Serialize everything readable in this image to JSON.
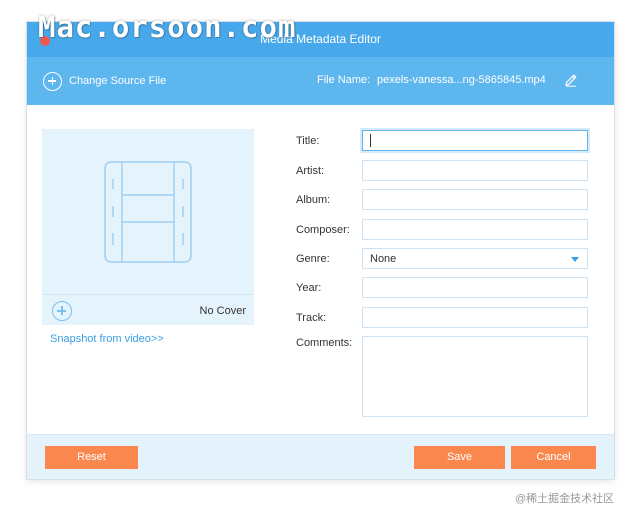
{
  "watermark": "Mac.orsoon.com",
  "window": {
    "title": "Media Metadata Editor"
  },
  "toolbar": {
    "change_source_label": "Change Source File",
    "file_name_label": "File Name:",
    "file_name_value": "pexels-vanessa...ng-5865845.mp4",
    "edit_icon": "pencil-icon"
  },
  "cover": {
    "no_cover_label": "No Cover",
    "snapshot_link": "Snapshot from video>>",
    "art_icon": "film-strip-icon",
    "add_icon": "plus-circle-icon"
  },
  "form": {
    "title_label": "Title:",
    "title_value": "",
    "artist_label": "Artist:",
    "artist_value": "",
    "album_label": "Album:",
    "album_value": "",
    "composer_label": "Composer:",
    "composer_value": "",
    "genre_label": "Genre:",
    "genre_value": "None",
    "year_label": "Year:",
    "year_value": "",
    "track_label": "Track:",
    "track_value": "",
    "comments_label": "Comments:",
    "comments_value": ""
  },
  "footer": {
    "reset_label": "Reset",
    "save_label": "Save",
    "cancel_label": "Cancel"
  },
  "credit": "@稀土掘金技术社区",
  "colors": {
    "titlebar": "#47a9eb",
    "toolbar": "#5eb6ef",
    "accent_link": "#3b9fe4",
    "button": "#f9874e",
    "cover_bg": "#e5f3fc",
    "footer_bg": "#e4f2fc"
  }
}
